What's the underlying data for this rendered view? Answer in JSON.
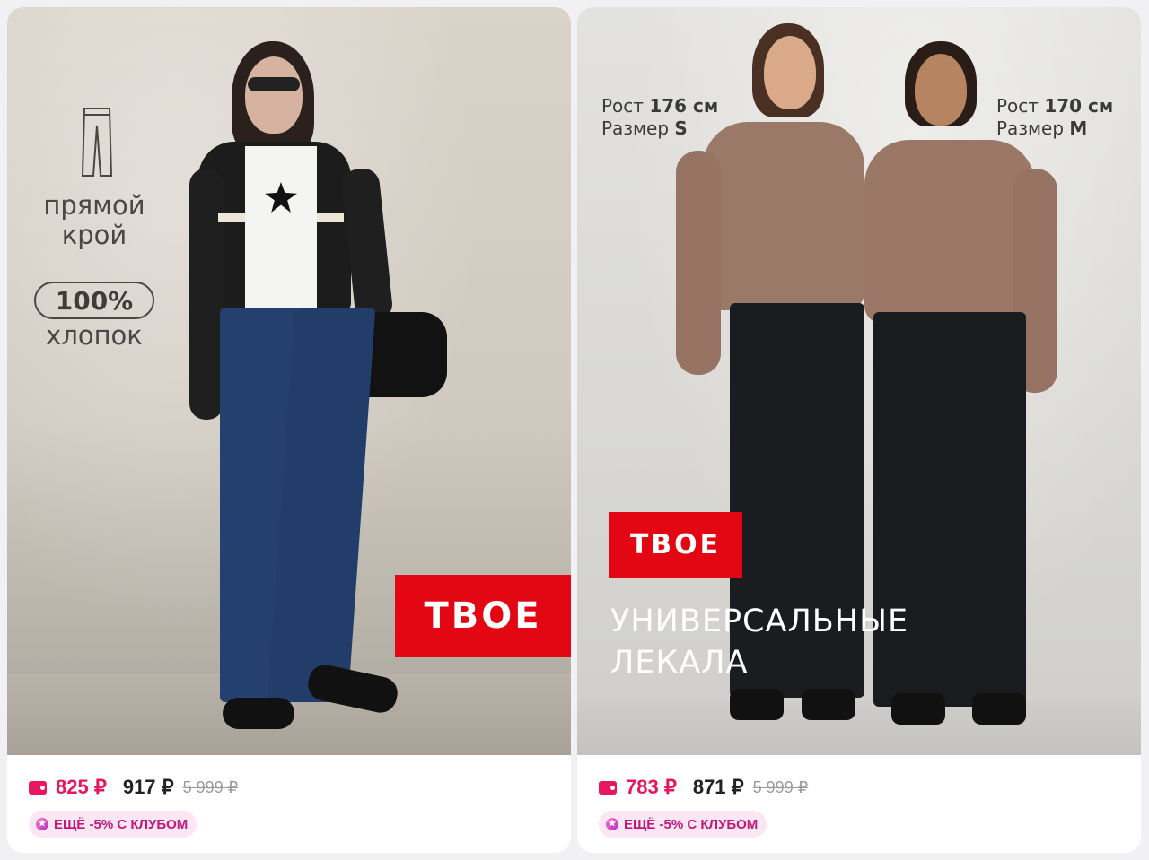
{
  "colors": {
    "brand_red": "#e30613",
    "card_price": "#e8175d",
    "club_badge_bg": "#fbe6f3",
    "club_badge_text": "#c2187a"
  },
  "cards": [
    {
      "brand": "ТВОЕ",
      "features": {
        "icon": "pants-icon",
        "cut_line1": "прямой",
        "cut_line2": "крой",
        "percent": "100%",
        "material": "хлопок"
      },
      "price_card": "825 ₽",
      "price": "917 ₽",
      "price_old": "5 999 ₽",
      "club_label": "ЕЩЁ -5% С КЛУБОМ"
    },
    {
      "brand": "ТВОЕ",
      "model1": {
        "height_label": "Рост",
        "height_value": "176 см",
        "size_label": "Размер",
        "size_value": "S"
      },
      "model2": {
        "height_label": "Рост",
        "height_value": "170 см",
        "size_label": "Размер",
        "size_value": "M"
      },
      "headline_line1": "УНИВЕРСАЛЬНЫЕ",
      "headline_line2": "ЛЕКАЛА",
      "price_card": "783 ₽",
      "price": "871 ₽",
      "price_old": "5 999 ₽",
      "club_label": "ЕЩЁ -5% С КЛУБОМ"
    }
  ]
}
